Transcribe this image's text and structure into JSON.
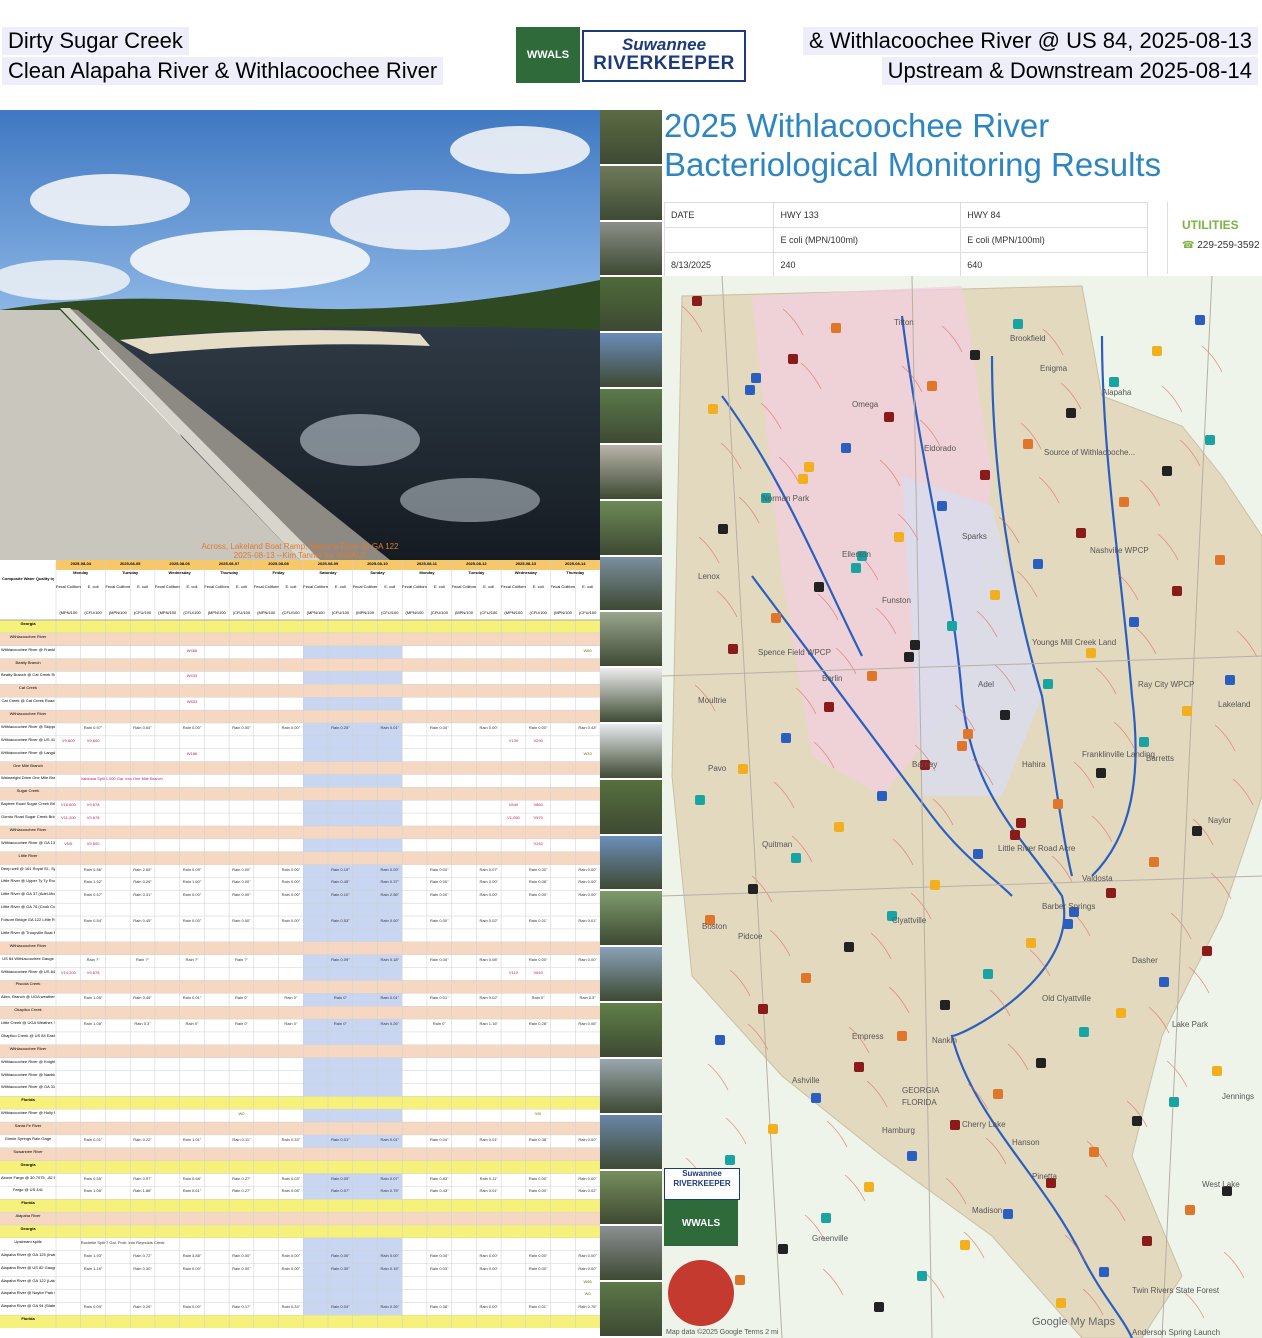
{
  "header": {
    "left_line1": "Dirty Sugar Creek",
    "left_line2": "Clean Alapaha River & Withlacoochee River",
    "right_line1": "& Withlacoochee River @ US 84, 2025-08-13",
    "right_line2": "Upstream & Downstream 2025-08-14"
  },
  "logo": {
    "line1": "Suwannee",
    "line2": "RIVERKEEPER",
    "badge": "WWALS"
  },
  "photo": {
    "caption": "Across, Lakeland Boat Ramp, Alapaha River @ GA 122\n2025-08-13 --Kim Tanner for WWALS"
  },
  "monitoring": {
    "title": "2025 Withlacoochee River Bacteriological Monitoring Results",
    "headers": [
      "DATE",
      "HWY 133",
      "HWY 84"
    ],
    "units": [
      "",
      "E coli (MPN/100ml)",
      "E coli (MPN/100ml)"
    ],
    "row": [
      "8/13/2025",
      "240",
      "640"
    ],
    "utilities_label": "UTILITIES",
    "utilities_phone": "229-259-3592"
  },
  "map": {
    "labels": [
      "Tifton",
      "Brookfield",
      "Enigma",
      "Eldorado",
      "Alapaha",
      "Norman Park",
      "Omega",
      "Nashville WPCP",
      "Source of Withlacooche...",
      "Lenox",
      "Ellenton",
      "Sparks",
      "Adel",
      "Spence Field WPCP",
      "Youngs Mill Creek Land",
      "Ray City WPCP",
      "Lakeland",
      "Barretts",
      "Berlin",
      "Funston",
      "Barney",
      "Moultrie",
      "Pavo",
      "Franklinville Landing",
      "Naylor",
      "Hahira",
      "Quitman",
      "Little River Road Acre",
      "Valdosta",
      "Barber Springs",
      "Boston",
      "Pidcoe",
      "Clyattville",
      "Dasher",
      "Old Clyattville",
      "Lake Park",
      "Empress",
      "Nankin",
      "Ashville",
      "GEORGIA",
      "FLORIDA",
      "Cherry Lake",
      "Pinetta",
      "Jennings",
      "Hamburg",
      "Hanson",
      "West Lake",
      "Greenville",
      "Madison",
      "Twin Rivers State Forest",
      "Anderson Spring Launch"
    ],
    "credit": "Map data ©2025 Google   Terms   2 mi",
    "google": "Google My Maps"
  },
  "sheet": {
    "dates": [
      "2025-08-04",
      "2025-08-05",
      "2025-08-06",
      "2025-08-07",
      "2025-08-08",
      "2025-08-09",
      "2025-08-10",
      "2025-08-11",
      "2025-08-12",
      "2025-08-13",
      "2025-08-14"
    ],
    "days": [
      "Monday",
      "Tuesday",
      "Wednesday",
      "Thursday",
      "Friday",
      "Saturday",
      "Sunday",
      "Monday",
      "Tuesday",
      "Wednesday",
      "Thursday"
    ],
    "sub_headers": [
      "Fecal Coliform",
      "E. coli"
    ],
    "units": [
      "(MPN/100",
      "(CFU/100"
    ],
    "corner": "Composite Water Quality by WWALS",
    "rows": [
      {
        "label": "Georgia",
        "type": "section"
      },
      {
        "label": "Withlacoochee River",
        "type": "band"
      },
      {
        "label": "Withlacoochee River @ Franklinville Road (Tyler Bridge)",
        "type": "data",
        "cells": {
          "5": "W466",
          "21": "W60"
        }
      },
      {
        "label": "Beatty Branch",
        "type": "band"
      },
      {
        "label": "Beatty Branch @ Cat Creek Road",
        "type": "data",
        "cells": {
          "5": "W433"
        }
      },
      {
        "label": "Cat Creek",
        "type": "band"
      },
      {
        "label": "Cat Creek @ Cat Creek Road",
        "type": "data",
        "cells": {
          "5": "W833"
        }
      },
      {
        "label": "Withlacoochee River",
        "type": "band"
      },
      {
        "label": "Withlacoochee River @ Skipper Bridge Gauge",
        "type": "data",
        "cells": {
          "1": "Rain 0.97\"",
          "3": "Rain 0.64\"",
          "5": "Rain 0.00\"",
          "7": "Rain 0.00\"",
          "9": "Rain 0.00\"",
          "11": "Rain 0.25\"",
          "13": "Rain 0.01\"",
          "15": "Rain 0.00\"",
          "17": "Rain 0.00\"",
          "19": "Rain 0.00\"",
          "21": "Rain 0.43\""
        }
      },
      {
        "label": "Withlacoochee River @ US 41 (N. Valdosta Rd.)",
        "type": "data",
        "cells": {
          "0": "V9,600",
          "1": "V9,600",
          "18": "V130",
          "19": "V290"
        }
      },
      {
        "label": "Withlacoochee River @ Langdale Park Boat Ramp",
        "type": "data",
        "cells": {
          "5": "W186",
          "21": "W33"
        }
      },
      {
        "label": "One Mile Branch",
        "type": "band"
      },
      {
        "label": "Wainwright Drive One Mile Branch Bridge",
        "type": "data",
        "cells": {
          "1": "Valdosta Spill 1,000 Gal. into One Mile Branch"
        }
      },
      {
        "label": "Sugar Creek",
        "type": "band"
      },
      {
        "label": "Baytree Road Sugar Creek Bridge",
        "type": "data",
        "cells": {
          "0": "V16,600",
          "1": "V9,678",
          "18": "V840",
          "19": "V860"
        }
      },
      {
        "label": "Gornto Road Sugar Creek Bridge",
        "type": "data",
        "cells": {
          "0": "V11,200",
          "1": "V9,678",
          "18": "V1,050",
          "19": "V970"
        }
      },
      {
        "label": "Withlacoochee River",
        "type": "band"
      },
      {
        "label": "Withlacoochee River @ GA 133",
        "type": "data",
        "cells": {
          "0": "VNS",
          "1": "V9,600",
          "19": "V240"
        }
      },
      {
        "label": "Little River",
        "type": "band"
      },
      {
        "label": "Deep well @ 161 Royal St., Sylvester",
        "type": "data",
        "cells": {
          "1": "Rain 0.56\"",
          "3": "Rain 2.65\"",
          "5": "Rain 0.09\"",
          "7": "Rain 0.00\"",
          "9": "Rain 0.00\"",
          "11": "Rain 0.19\"",
          "13": "Rain 0.09\"",
          "15": "Rain 0.00\"",
          "17": "Rain 0.07\"",
          "19": "Rain 0.00\"",
          "21": "Rain 0.00\""
        }
      },
      {
        "label": "Little River @ Upper Ty Ty Road (Tifton)",
        "type": "data",
        "cells": {
          "1": "Rain 1.92\"",
          "3": "Rain 0.26\"",
          "5": "Rain 1.60\"",
          "7": "Rain 0.00\"",
          "9": "Rain 0.00\"",
          "11": "Rain 0.45\"",
          "13": "Rain 0.37\"",
          "15": "Rain 0.00\"",
          "17": "Rain 0.00\"",
          "19": "Rain 0.08\"",
          "21": "Rain 0.00\""
        }
      },
      {
        "label": "Little River @ GA 37 (Adel-Moultrie Landing)",
        "type": "data",
        "cells": {
          "1": "Rain 0.57\"",
          "3": "Rain 0.31\"",
          "5": "Rain 0.00\"",
          "7": "Rain 0.00\"",
          "9": "Rain 0.00\"",
          "11": "Rain 0.10\"",
          "13": "Rain 2.56\"",
          "15": "Rain 0.00\"",
          "17": "Rain 0.00\"",
          "19": "Rain 0.00\"",
          "21": "Rain 0.00\""
        }
      },
      {
        "label": "Little River @ GA 76 (Cook County Boat Ramp)",
        "type": "data",
        "cells": {}
      },
      {
        "label": "Folsom Bridge GA 122 Little River Gauge",
        "type": "data",
        "cells": {
          "1": "Rain 0.54\"",
          "3": "Rain 0.45\"",
          "5": "Rain 0.00\"",
          "7": "Rain 0.00\"",
          "9": "Rain 0.00\"",
          "11": "Rain 0.53\"",
          "13": "Rain 0.00\"",
          "15": "Rain 0.00\"",
          "17": "Rain 0.02\"",
          "19": "Rain 0.01\"",
          "21": "Rain 0.01\""
        }
      },
      {
        "label": "Little River @ Troupville Boat Ramp",
        "type": "data",
        "cells": {}
      },
      {
        "label": "Withlacoochee River",
        "type": "band"
      },
      {
        "label": "US 84 Withlacoochee Gauge",
        "type": "data",
        "cells": {
          "1": "Rain ?\"",
          "3": "Rain ?\"",
          "5": "Rain ?\"",
          "7": "Rain ?\"",
          "11": "Rain 0.09\"",
          "13": "Rain 0.18\"",
          "15": "Rain 0.00\"",
          "17": "Rain 0.08\"",
          "19": "Rain 0.00\"",
          "21": "Rain 0.00\""
        }
      },
      {
        "label": "Withlacoochee River @ US 84 W",
        "type": "data",
        "cells": {
          "0": "V14,200",
          "1": "V9,678",
          "18": "V110",
          "19": "V640"
        }
      },
      {
        "label": "Piscola Creek",
        "type": "band"
      },
      {
        "label": "Allen, Branch @ UGA weather, 4281 US 84, Dixie, GA",
        "type": "data",
        "cells": {
          "1": "Rain 1.05\"",
          "3": "Rain 0.46\"",
          "5": "Rain 0.01\"",
          "7": "Rain 0\"",
          "9": "Rain 0\"",
          "11": "Rain 0\"",
          "13": "Rain 0.01\"",
          "15": "Rain 0.01\"",
          "17": "Rain 0.02\"",
          "19": "Rain 0\"",
          "21": "Rain 0.5\""
        }
      },
      {
        "label": "Okapilco Creek",
        "type": "band"
      },
      {
        "label": "Little Creek @ UGA Weather, Spence Field, Moultrie, GA",
        "type": "data",
        "cells": {
          "1": "Rain 1.08\"",
          "3": "Rain 0.3\"",
          "5": "Rain 0\"",
          "7": "Rain 0\"",
          "9": "Rain 0\"",
          "11": "Rain 0\"",
          "13": "Rain 0.26\"",
          "15": "Rain 0\"",
          "17": "Rain 1.16\"",
          "19": "Rain 0.28\"",
          "21": "Rain 0.06\""
        }
      },
      {
        "label": "Okapilco Creek @ US 84 East of Quitman",
        "type": "data",
        "cells": {}
      },
      {
        "label": "Withlacoochee River",
        "type": "band"
      },
      {
        "label": "Withlacoochee River @ Knights Ferry Boat Ramp",
        "type": "data",
        "cells": {}
      },
      {
        "label": "Withlacoochee River @ Nankin Boat Ramp",
        "type": "data",
        "cells": {}
      },
      {
        "label": "Withlacoochee River @ GA 31 (CR 145, Madison Highway, State Line Boat Ramp, Mozell Spells)",
        "type": "data",
        "cells": {}
      },
      {
        "label": "Florida",
        "type": "section"
      },
      {
        "label": "Withlacoochee River @ Holly Point",
        "type": "data",
        "cells": {
          "7": "W0",
          "19": "W0"
        }
      },
      {
        "label": "Santa Fe River",
        "type": "band"
      },
      {
        "label": "Ginnie Springs Rain Gage",
        "type": "data",
        "cells": {
          "1": "Rain 0.01\"",
          "3": "Rain 0.22\"",
          "5": "Rain 1.01\"",
          "7": "Rain 0.11\"",
          "9": "Rain 0.33\"",
          "11": "Rain 0.01\"",
          "13": "Rain 0.01\"",
          "15": "Rain 0.04\"",
          "17": "Rain 0.01\"",
          "19": "Rain 0.38\"",
          "21": "Rain 0.00\""
        }
      },
      {
        "label": "Suwannee River",
        "type": "band"
      },
      {
        "label": "Georgia",
        "type": "section"
      },
      {
        "label": "Above Fargo @ 30.7075, -82.53917",
        "type": "data",
        "cells": {
          "1": "Rain 0.55\"",
          "3": "Rain 0.97\"",
          "5": "Rain 0.68\"",
          "7": "Rain 0.27\"",
          "9": "Rain 0.03\"",
          "11": "Rain 0.00\"",
          "13": "Rain 0.07\"",
          "15": "Rain 0.83\"",
          "17": "Rain 0.11\"",
          "19": "Rain 0.00\"",
          "21": "Rain 0.00\""
        }
      },
      {
        "label": "Fargo @ US 441",
        "type": "data",
        "cells": {
          "1": "Rain 1.06\"",
          "3": "Rain 1.88\"",
          "5": "Rain 0.61\"",
          "7": "Rain 0.27\"",
          "9": "Rain 0.06\"",
          "11": "Rain 0.07\"",
          "13": "Rain 0.75\"",
          "15": "Rain 0.43\"",
          "17": "Rain 0.01\"",
          "19": "Rain 0.00\"",
          "21": "Rain 0.02\""
        }
      },
      {
        "label": "Florida",
        "type": "section"
      },
      {
        "label": "Alapaha River",
        "type": "band"
      },
      {
        "label": "Georgia",
        "type": "section"
      },
      {
        "label": "Upstream spills",
        "type": "data",
        "cells": {
          "1": "Rochelle Spill 7 Gal. Prob. into Reynolds Creek"
        }
      },
      {
        "label": "Alapaha River @ GA 125 (Irwinville)",
        "type": "data",
        "cells": {
          "1": "Rain 1.93\"",
          "3": "Rain 0.72\"",
          "5": "Rain 3.88\"",
          "7": "Rain 0.00\"",
          "9": "Rain 0.00\"",
          "11": "Rain 0.00\"",
          "13": "Rain 0.00\"",
          "15": "Rain 0.00\"",
          "17": "Rain 0.00\"",
          "19": "Rain 0.00\"",
          "21": "Rain 0.00\""
        }
      },
      {
        "label": "Alapaha River @ US 82 Gauge",
        "type": "data",
        "cells": {
          "1": "Rain 1.16\"",
          "3": "Rain 0.30\"",
          "5": "Rain 0.00\"",
          "7": "Rain 0.00\"",
          "9": "Rain 0.00\"",
          "11": "Rain 0.30\"",
          "13": "Rain 0.15\"",
          "15": "Rain 0.03\"",
          "17": "Rain 0.00\"",
          "19": "Rain 0.00\"",
          "21": "Rain 0.00\""
        }
      },
      {
        "label": "Alapaha River @ GA 122 (Lakeland Boat Ramp)",
        "type": "data",
        "cells": {
          "21": "W66"
        }
      },
      {
        "label": "Alapaha River @ Naylor Park Beach (Naylor Boat Ramp)",
        "type": "data",
        "cells": {
          "21": "W0"
        }
      },
      {
        "label": "Alapaha River @ GA 94 (Statenville Boat Ramp)",
        "type": "data",
        "cells": {
          "1": "Rain 0.09\"",
          "3": "Rain 0.25\"",
          "5": "Rain 0.00\"",
          "7": "Rain 0.17\"",
          "9": "Rain 0.34\"",
          "11": "Rain 0.04\"",
          "13": "Rain 0.26\"",
          "15": "Rain 0.38\"",
          "17": "Rain 0.00\"",
          "19": "Rain 0.01\"",
          "21": "Rain 0.76\""
        }
      },
      {
        "label": "Florida",
        "type": "section"
      }
    ]
  }
}
